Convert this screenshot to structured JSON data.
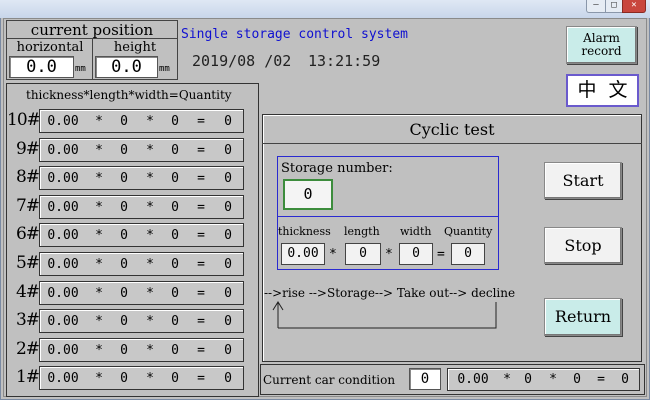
{
  "window": {
    "min": "–",
    "max": "□",
    "close": "✕"
  },
  "position": {
    "title": "current position",
    "horizontal_label": "horizontal",
    "horizontal_value": "0.0",
    "horizontal_unit": "mm",
    "height_label": "height",
    "height_value": "0.0",
    "height_unit": "mm"
  },
  "header": {
    "title": "Single storage control system",
    "date": "2019/08 /02",
    "time": "13:21:59"
  },
  "buttons": {
    "alarm_line1": "Alarm",
    "alarm_line2": "record",
    "language": "中  文",
    "start": "Start",
    "stop": "Stop",
    "return": "Return"
  },
  "table": {
    "header": {
      "thickness": "thickness",
      "star1": "*",
      "length": "length",
      "star2": "*",
      "width": "width",
      "eq": "=",
      "quantity": "Quantity"
    },
    "rows": [
      {
        "label": "10#",
        "thickness": "0.00",
        "length": "0",
        "width": "0",
        "quantity": "0"
      },
      {
        "label": "9#",
        "thickness": "0.00",
        "length": "0",
        "width": "0",
        "quantity": "0"
      },
      {
        "label": "8#",
        "thickness": "0.00",
        "length": "0",
        "width": "0",
        "quantity": "0"
      },
      {
        "label": "7#",
        "thickness": "0.00",
        "length": "0",
        "width": "0",
        "quantity": "0"
      },
      {
        "label": "6#",
        "thickness": "0.00",
        "length": "0",
        "width": "0",
        "quantity": "0"
      },
      {
        "label": "5#",
        "thickness": "0.00",
        "length": "0",
        "width": "0",
        "quantity": "0"
      },
      {
        "label": "4#",
        "thickness": "0.00",
        "length": "0",
        "width": "0",
        "quantity": "0"
      },
      {
        "label": "3#",
        "thickness": "0.00",
        "length": "0",
        "width": "0",
        "quantity": "0"
      },
      {
        "label": "2#",
        "thickness": "0.00",
        "length": "0",
        "width": "0",
        "quantity": "0"
      },
      {
        "label": "1#",
        "thickness": "0.00",
        "length": "0",
        "width": "0",
        "quantity": "0"
      }
    ],
    "symbols": {
      "star": "*",
      "eq": "="
    }
  },
  "cyclic": {
    "title": "Cyclic test",
    "storage_label": "Storage number:",
    "storage_value": "0",
    "col_thickness": "thickness",
    "col_length": "length",
    "col_width": "width",
    "col_quantity": "Quantity",
    "val_thickness": "0.00",
    "val_length": "0",
    "val_width": "0",
    "val_quantity": "0",
    "flow": "-->rise -->Storage--> Take out--> decline"
  },
  "status": {
    "car_label": "Current car condition",
    "car_value": "0",
    "summary_thickness": "0.00",
    "summary_length": "0",
    "summary_width": "0",
    "summary_quantity": "0"
  }
}
